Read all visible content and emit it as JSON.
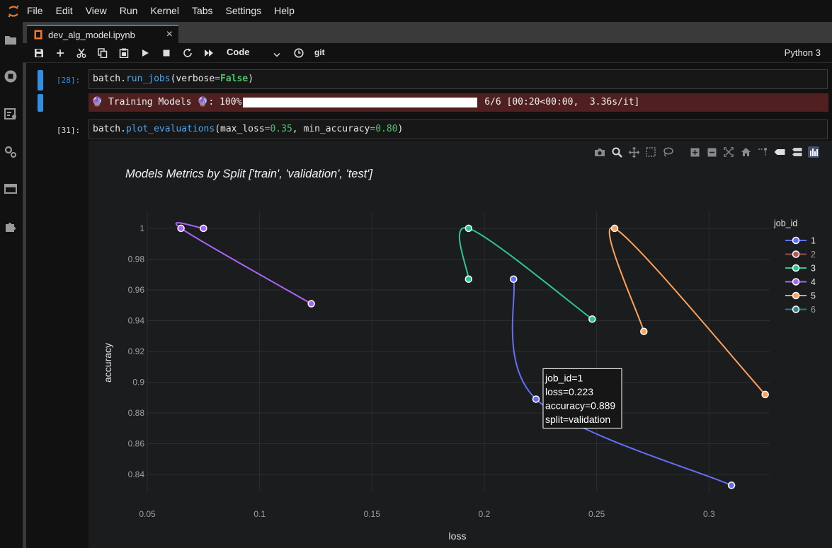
{
  "menu": [
    "File",
    "Edit",
    "View",
    "Run",
    "Kernel",
    "Tabs",
    "Settings",
    "Help"
  ],
  "tab": {
    "label": "dev_alg_model.ipynb",
    "close": "×"
  },
  "toolbar": {
    "cell_type": "Code",
    "git": "git",
    "kernel": "Python 3"
  },
  "cells": [
    {
      "prompt": "[28]:",
      "code": {
        "obj": "batch",
        "fn": "run_jobs",
        "arg": "verbose",
        "val": "False"
      }
    },
    {
      "prompt": "[31]:",
      "code": {
        "obj": "batch",
        "fn": "plot_evaluations",
        "arg1": "max_loss",
        "val1": "0.35",
        "arg2": "min_accuracy",
        "val2": "0.80"
      }
    }
  ],
  "progress": {
    "prefix": "🔮 Training Models 🔮: 100%",
    "suffix": " 6/6 [00:20<00:00,  3.36s/it]",
    "fraction": 1.0
  },
  "icons": {
    "activity": [
      "folder-icon",
      "running-icon",
      "commands-icon",
      "property-inspector-icon",
      "tabs-icon",
      "extension-icon"
    ],
    "toolbar": [
      "save-icon",
      "add-icon",
      "cut-icon",
      "copy-icon",
      "paste-icon",
      "run-icon",
      "stop-icon",
      "restart-icon",
      "run-all-icon",
      "clock-icon"
    ],
    "modebar": [
      "camera-icon",
      "zoom-icon",
      "pan-icon",
      "box-select-icon",
      "lasso-icon",
      "zoom-in-icon",
      "zoom-out-icon",
      "autoscale-icon",
      "home-icon",
      "spike-icon",
      "hover-closest-icon",
      "hover-compare-icon",
      "plotly-logo-icon"
    ]
  },
  "colors": {
    "accent": "#2f8fe0",
    "stderr_bg": "#502020",
    "plot_bg": "#1b1c1e"
  },
  "chart_data": {
    "type": "line",
    "title": "Models Metrics by Split ['train', 'validation', 'test']",
    "xlabel": "loss",
    "ylabel": "accuracy",
    "xlim": [
      0.05,
      0.327
    ],
    "ylim": [
      0.829,
      1.011
    ],
    "xticks": [
      0.05,
      0.1,
      0.15,
      0.2,
      0.25,
      0.3
    ],
    "xtick_labels": [
      "0.05",
      "0.1",
      "0.15",
      "0.2",
      "0.25",
      "0.3"
    ],
    "yticks": [
      0.84,
      0.86,
      0.88,
      0.9,
      0.92,
      0.94,
      0.96,
      0.98,
      1.0
    ],
    "ytick_labels": [
      "0.84",
      "0.86",
      "0.88",
      "0.9",
      "0.92",
      "0.94",
      "0.96",
      "0.98",
      "1"
    ],
    "legend_title": "job_id",
    "legend_position": "top-right",
    "grid": true,
    "series": [
      {
        "name": "1",
        "color": "#636efa",
        "points": [
          [
            0.213,
            0.967
          ],
          [
            0.223,
            0.889
          ],
          [
            0.31,
            0.833
          ]
        ]
      },
      {
        "name": "2",
        "color": "#ab5b53",
        "points": []
      },
      {
        "name": "3",
        "color": "#2fc590",
        "points": [
          [
            0.193,
            0.967
          ],
          [
            0.193,
            1.0
          ],
          [
            0.248,
            0.941
          ]
        ]
      },
      {
        "name": "4",
        "color": "#ab63fa",
        "points": [
          [
            0.075,
            1.0
          ],
          [
            0.065,
            1.0
          ],
          [
            0.123,
            0.951
          ]
        ]
      },
      {
        "name": "5",
        "color": "#ffa15a",
        "points": [
          [
            0.271,
            0.933
          ],
          [
            0.258,
            1.0
          ],
          [
            0.325,
            0.892
          ]
        ]
      },
      {
        "name": "6",
        "color": "#2f8c8a",
        "points": []
      }
    ],
    "hover": {
      "series": 0,
      "point": 1,
      "lines": [
        "job_id=1",
        "loss=0.223",
        "accuracy=0.889",
        "split=validation"
      ]
    }
  }
}
